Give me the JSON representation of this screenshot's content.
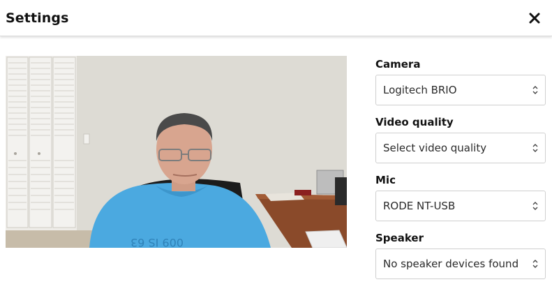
{
  "header": {
    "title": "Settings",
    "close_icon": "close-icon"
  },
  "preview": {
    "description_icon": "webcam-preview-image"
  },
  "fields": [
    {
      "label": "Camera",
      "value": "Logitech BRIO"
    },
    {
      "label": "Video quality",
      "value": "Select video quality"
    },
    {
      "label": "Mic",
      "value": "RODE NT-USB"
    },
    {
      "label": "Speaker",
      "value": "No speaker devices found"
    }
  ],
  "colors": {
    "text": "#111111",
    "border": "#cfcfcf",
    "shirt": "#4ba9e0",
    "wall": "#d8d6cf"
  }
}
